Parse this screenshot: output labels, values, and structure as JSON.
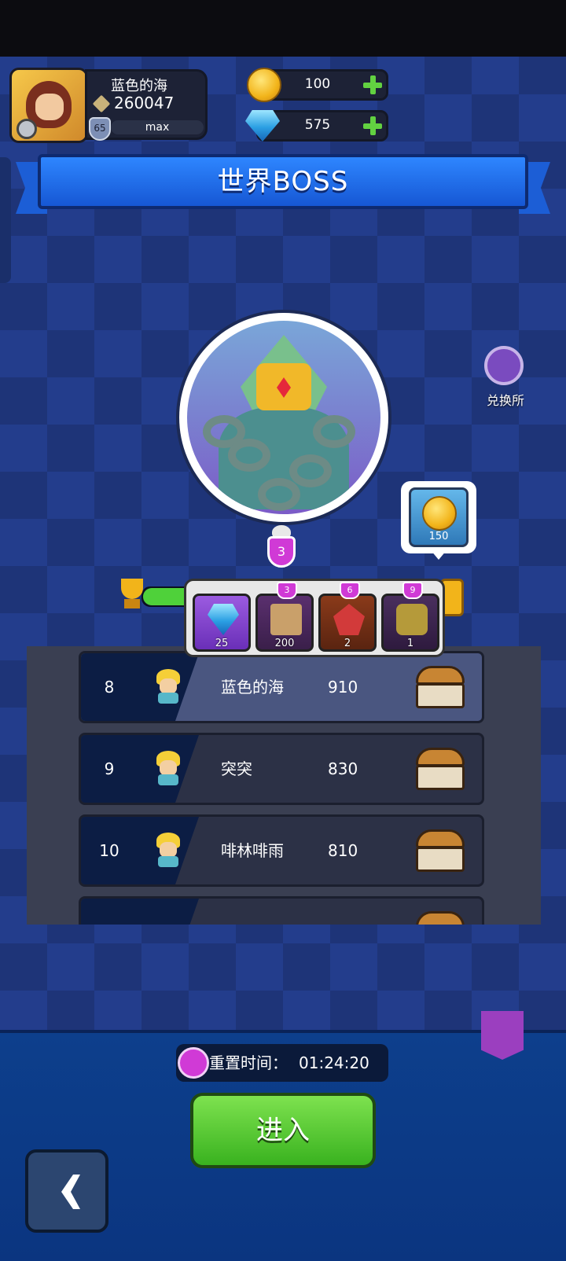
{
  "player": {
    "name": "蓝色的海",
    "power": "260047",
    "level": "65",
    "level_bar": "max"
  },
  "currency": {
    "gold": "100",
    "gems": "575"
  },
  "title": "世界BOSS",
  "boss": {
    "level_badge": "3"
  },
  "exchange_label": "兑换所",
  "reward_bubble": {
    "count": "150"
  },
  "progress": {
    "fraction": 0.35
  },
  "rewards_popup": [
    {
      "icon": "diamond-icon",
      "count": "25",
      "badge": ""
    },
    {
      "icon": "map-scroll-icon",
      "count": "200",
      "badge": "3"
    },
    {
      "icon": "red-crystal-icon",
      "count": "2",
      "badge": "6"
    },
    {
      "icon": "mask-icon",
      "count": "1",
      "badge": "9"
    }
  ],
  "leaderboard": [
    {
      "rank": "8",
      "name": "蓝色的海",
      "score": "910"
    },
    {
      "rank": "9",
      "name": "突突",
      "score": "830"
    },
    {
      "rank": "10",
      "name": "啡林啡雨",
      "score": "810"
    }
  ],
  "reset": {
    "label": "重置时间：",
    "time": "01:24:20"
  },
  "enter_label": "进入"
}
